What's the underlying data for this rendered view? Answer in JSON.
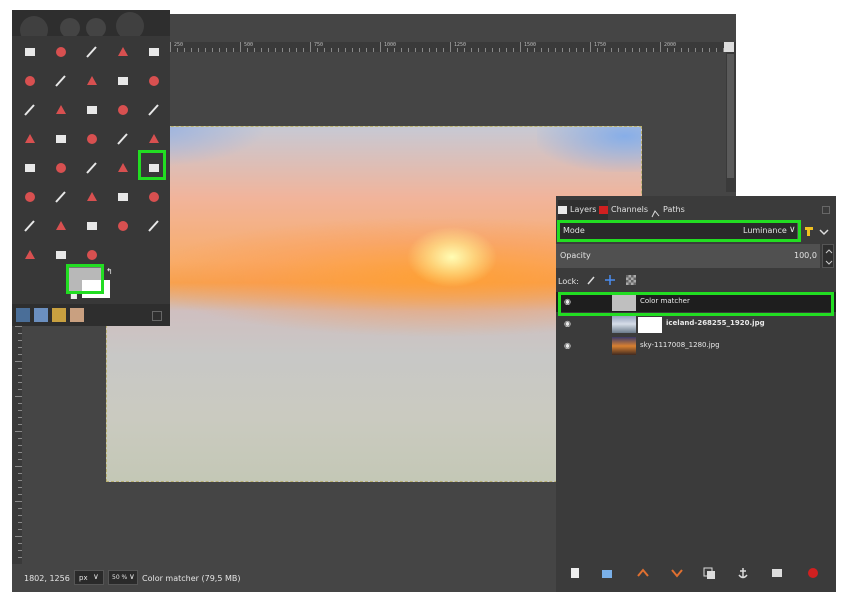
{
  "window": {
    "background": "#454545"
  },
  "ruler": {
    "top_labels": [
      "250",
      "500",
      "750",
      "1000",
      "1250",
      "1500",
      "1750",
      "2000"
    ]
  },
  "toolbox": {
    "tools": [
      "rect-select-icon",
      "ellipse-select-icon",
      "free-select-icon",
      "fuzzy-select-icon",
      "by-color-select-icon",
      "crop-icon",
      "scissors-icon",
      "foreground-select-icon",
      "paths-icon",
      "color-picker-icon",
      "measure-icon",
      "move-icon",
      "align-icon",
      "transform-icon",
      "unified-transform-icon",
      "warp-icon",
      "rotate-icon",
      "perspective-icon",
      "flip-icon",
      "shear-icon",
      "cage-icon",
      "handle-transform-icon",
      "text-icon",
      "bucket-fill-icon",
      "gradient-icon",
      "paintbrush-icon",
      "pencil-icon",
      "airbrush-icon",
      "eraser-icon",
      "ink-icon",
      "mypaint-icon",
      "clone-icon",
      "heal-icon",
      "perspective-clone-icon",
      "blur-icon",
      "smudge-icon",
      "dodge-icon",
      "burn-icon"
    ],
    "foreground_color": "#b8b8b8",
    "background_color": "#ffffff"
  },
  "dock": {
    "tabs": [
      {
        "label": "Layers"
      },
      {
        "label": "Channels"
      },
      {
        "label": "Paths"
      }
    ],
    "mode_label": "Mode",
    "mode_value": "Luminance",
    "opacity_label": "Opacity",
    "opacity_value": "100,0",
    "lock_label": "Lock:",
    "layers": [
      {
        "name": "Color matcher"
      },
      {
        "name": "iceland-268255_1920.jpg"
      },
      {
        "name": "sky-1117008_1280.jpg"
      }
    ]
  },
  "status": {
    "coords": "1802, 1256",
    "unit": "px",
    "zoom": "50 %",
    "message": "Color matcher (79,5 MB)"
  },
  "highlight_color": "#22dd22"
}
